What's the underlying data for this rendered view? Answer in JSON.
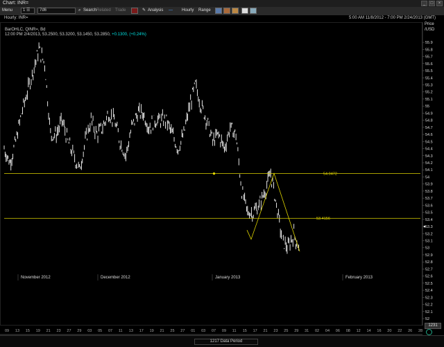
{
  "window": {
    "title": "Chart: INR=",
    "buttons": [
      "_",
      "□",
      "×"
    ]
  },
  "toolbar": {
    "menu": "Menu",
    "field1": "1  ☰",
    "field2": "7d6",
    "search": "Search",
    "related": "Related",
    "trade": "Trade",
    "analysis": "Analysis",
    "hourly": "Hourly",
    "range": "Range"
  },
  "header": {
    "ric_title": "Hourly: INR=",
    "time_range": "5:00 AM 11/8/2012 - 7:00 PM 2/24/2013 (GMT)"
  },
  "legend": {
    "line1": "BarOHLC, QINR=, Bd",
    "line2_prefix": "12:00 PM 2/4/2013, 53.2500, 53.3200, 53.1450, 53.2850,",
    "line2_change": "+0.1300, (+0.24%)",
    "price_label": "Price",
    "unit_label": "/USD"
  },
  "levels": {
    "upper": "54.0472",
    "lower": "53.4156"
  },
  "yaxis_ticks": [
    "55.9",
    "55.8",
    "55.7",
    "55.6",
    "55.5",
    "55.4",
    "55.3",
    "55.2",
    "55.1",
    "55",
    "54.9",
    "54.8",
    "54.7",
    "54.6",
    "54.5",
    "54.4",
    "54.3",
    "54.2",
    "54.1",
    "54",
    "53.9",
    "53.8",
    "53.7",
    "53.6",
    "53.5",
    "53.4",
    "53.3",
    "53.2",
    "53.1",
    "53",
    "52.9",
    "52.8",
    "52.7",
    "52.6",
    "52.5",
    "52.4",
    "52.3",
    "52.2",
    "52.1",
    "52"
  ],
  "months": [
    "November 2012",
    "December 2012",
    "January 2013",
    "February 2013"
  ],
  "xticks": [
    "09",
    "13",
    "15",
    "19",
    "21",
    "23",
    "27",
    "29",
    "03",
    "05",
    "07",
    "11",
    "13",
    "17",
    "19",
    "21",
    "25",
    "27",
    "01",
    "03",
    "07",
    "09",
    "11",
    "15",
    "17",
    "21",
    "23",
    "25",
    "29",
    "31",
    "02",
    "04",
    "06",
    "08",
    "12",
    "14",
    "16",
    "20",
    "22",
    "26",
    "28"
  ],
  "xmonths_bottom": [
    "November 2012",
    "December 2012",
    "January 2013",
    "February 2013"
  ],
  "status": {
    "period": "1217 Data Period",
    "price_box": "1231"
  },
  "colors": {
    "background": "#000000",
    "line": "#e0d500",
    "bars": "#ffffff",
    "change": "#00e0e0"
  },
  "chart_data": {
    "type": "line",
    "title": "Hourly: INR=",
    "ylabel": "Price /USD",
    "ylim": [
      52.0,
      55.95
    ],
    "series": [
      {
        "values": [
          54.4,
          54.2,
          54.5,
          54.9,
          55.2,
          55.5,
          55.8,
          55.6,
          54.6,
          54.6,
          54.8,
          54.5,
          54.3,
          54.1,
          54.5,
          54.8,
          54.6,
          54.7,
          54.9,
          54.8,
          54.5,
          54.3,
          54.7,
          54.9,
          54.9,
          54.7,
          54.8,
          54.8,
          54.8,
          54.6,
          54.4,
          54.6,
          55.0,
          55.3,
          55.0,
          54.8,
          54.5,
          54.6,
          54.4,
          54.7,
          54.6,
          53.8,
          53.5,
          53.5,
          53.6,
          53.8,
          54.05,
          53.6,
          53.1,
          53.0,
          53.2,
          52.95
        ]
      }
    ],
    "levels": [
      54.0472,
      53.4156
    ]
  }
}
